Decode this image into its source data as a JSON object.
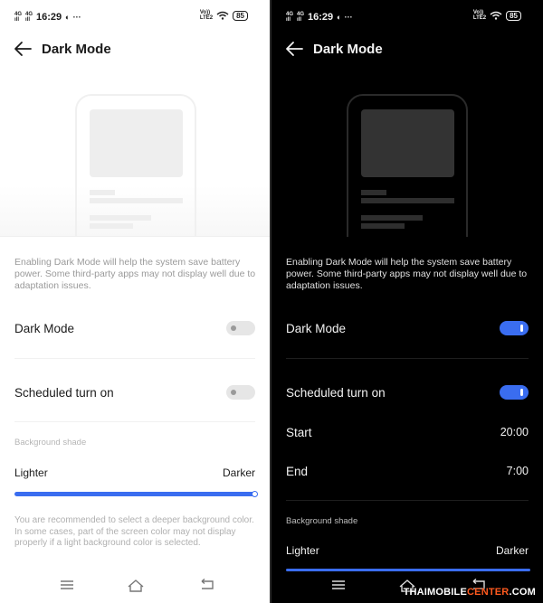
{
  "status_bar": {
    "network_top": "4G",
    "network_bottom": "ıll",
    "network2_top": "4G",
    "network2_bottom": "ıll",
    "time": "16:29",
    "volte_top": "Vo))",
    "volte_bottom": "LTE2",
    "battery": "85"
  },
  "light_screen": {
    "title": "Dark Mode",
    "description": "Enabling Dark Mode will help the system save battery power. Some third-party apps may not display well due to adaptation issues.",
    "dark_mode_label": "Dark Mode",
    "dark_mode_on": false,
    "scheduled_label": "Scheduled turn on",
    "scheduled_on": false,
    "background_shade_label": "Background shade",
    "lighter_label": "Lighter",
    "darker_label": "Darker",
    "shade_level": 1.0,
    "note": "You are recommended to select a deeper background color. In some cases, part of the screen color may not display properly if a light background color is selected."
  },
  "dark_screen": {
    "title": "Dark Mode",
    "description": "Enabling Dark Mode will help the system save battery power. Some third-party apps may not display well due to adaptation issues.",
    "dark_mode_label": "Dark Mode",
    "dark_mode_on": true,
    "scheduled_label": "Scheduled turn on",
    "scheduled_on": true,
    "start_label": "Start",
    "start_value": "20:00",
    "end_label": "End",
    "end_value": "7:00",
    "background_shade_label": "Background shade",
    "lighter_label": "Lighter",
    "darker_label": "Darker"
  },
  "watermark": {
    "prefix": "THAIMOBILE",
    "accent": "CENTER",
    "suffix": ".COM"
  },
  "colors": {
    "accent": "#3a6df0",
    "light_bg": "#ffffff",
    "dark_bg": "#000000"
  },
  "icons": [
    "back-arrow-icon",
    "wifi-icon",
    "menu-icon",
    "home-icon",
    "return-icon"
  ]
}
